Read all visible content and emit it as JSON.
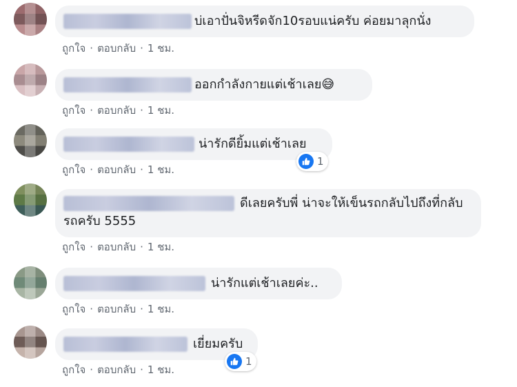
{
  "comments": [
    {
      "text": "บ่เอาปั่นจิหรีดจัก10รอบแน่ครับ ค่อยมาลุกนั่ง",
      "like": "ถูกใจ",
      "reply": "ตอบกลับ",
      "time": "1 ชม.",
      "avatar_colors": [
        "#9c6b6e",
        "#7d5a5c",
        "#b98c8e"
      ]
    },
    {
      "text": "ออกกำลังกายแต่เช้าเลย😅",
      "like": "ถูกใจ",
      "reply": "ตอบกลับ",
      "time": "1 ชม.",
      "avatar_colors": [
        "#c9a6a8",
        "#a98d91",
        "#d9bfc2"
      ]
    },
    {
      "text": "น่ารักดียิ้มแต่เช้าเลย",
      "like": "ถูกใจ",
      "reply": "ตอบกลับ",
      "time": "1 ชม.",
      "reactions": "1",
      "avatar_colors": [
        "#6b6a62",
        "#8d8a7d",
        "#4f4e4a"
      ]
    },
    {
      "text": "ดีเลยครับพี่ น่าจะให้เข็นรถกลับไปถึงที่กลับรถครับ 5555",
      "like": "ถูกใจ",
      "reply": "ตอบกลับ",
      "time": "1 ชม.",
      "avatar_colors": [
        "#7f8f5e",
        "#5e7a47",
        "#3f5f5a"
      ]
    },
    {
      "text": "น่ารักแต่เช้าเลยค่ะ..",
      "like": "ถูกใจ",
      "reply": "ตอบกลับ",
      "time": "1 ชม.",
      "avatar_colors": [
        "#8a9a86",
        "#6f8a78",
        "#a8b5a4"
      ]
    },
    {
      "text": "เยี่ยมครับ",
      "like": "ถูกใจ",
      "reply": "ตอบกลับ",
      "time": "1 ชม.",
      "reactions": "1",
      "avatar_colors": [
        "#a89690",
        "#6e5c57",
        "#c5b3ab"
      ]
    }
  ],
  "reaction_icon": "like-thumb-icon",
  "accent_color": "#1877f2"
}
